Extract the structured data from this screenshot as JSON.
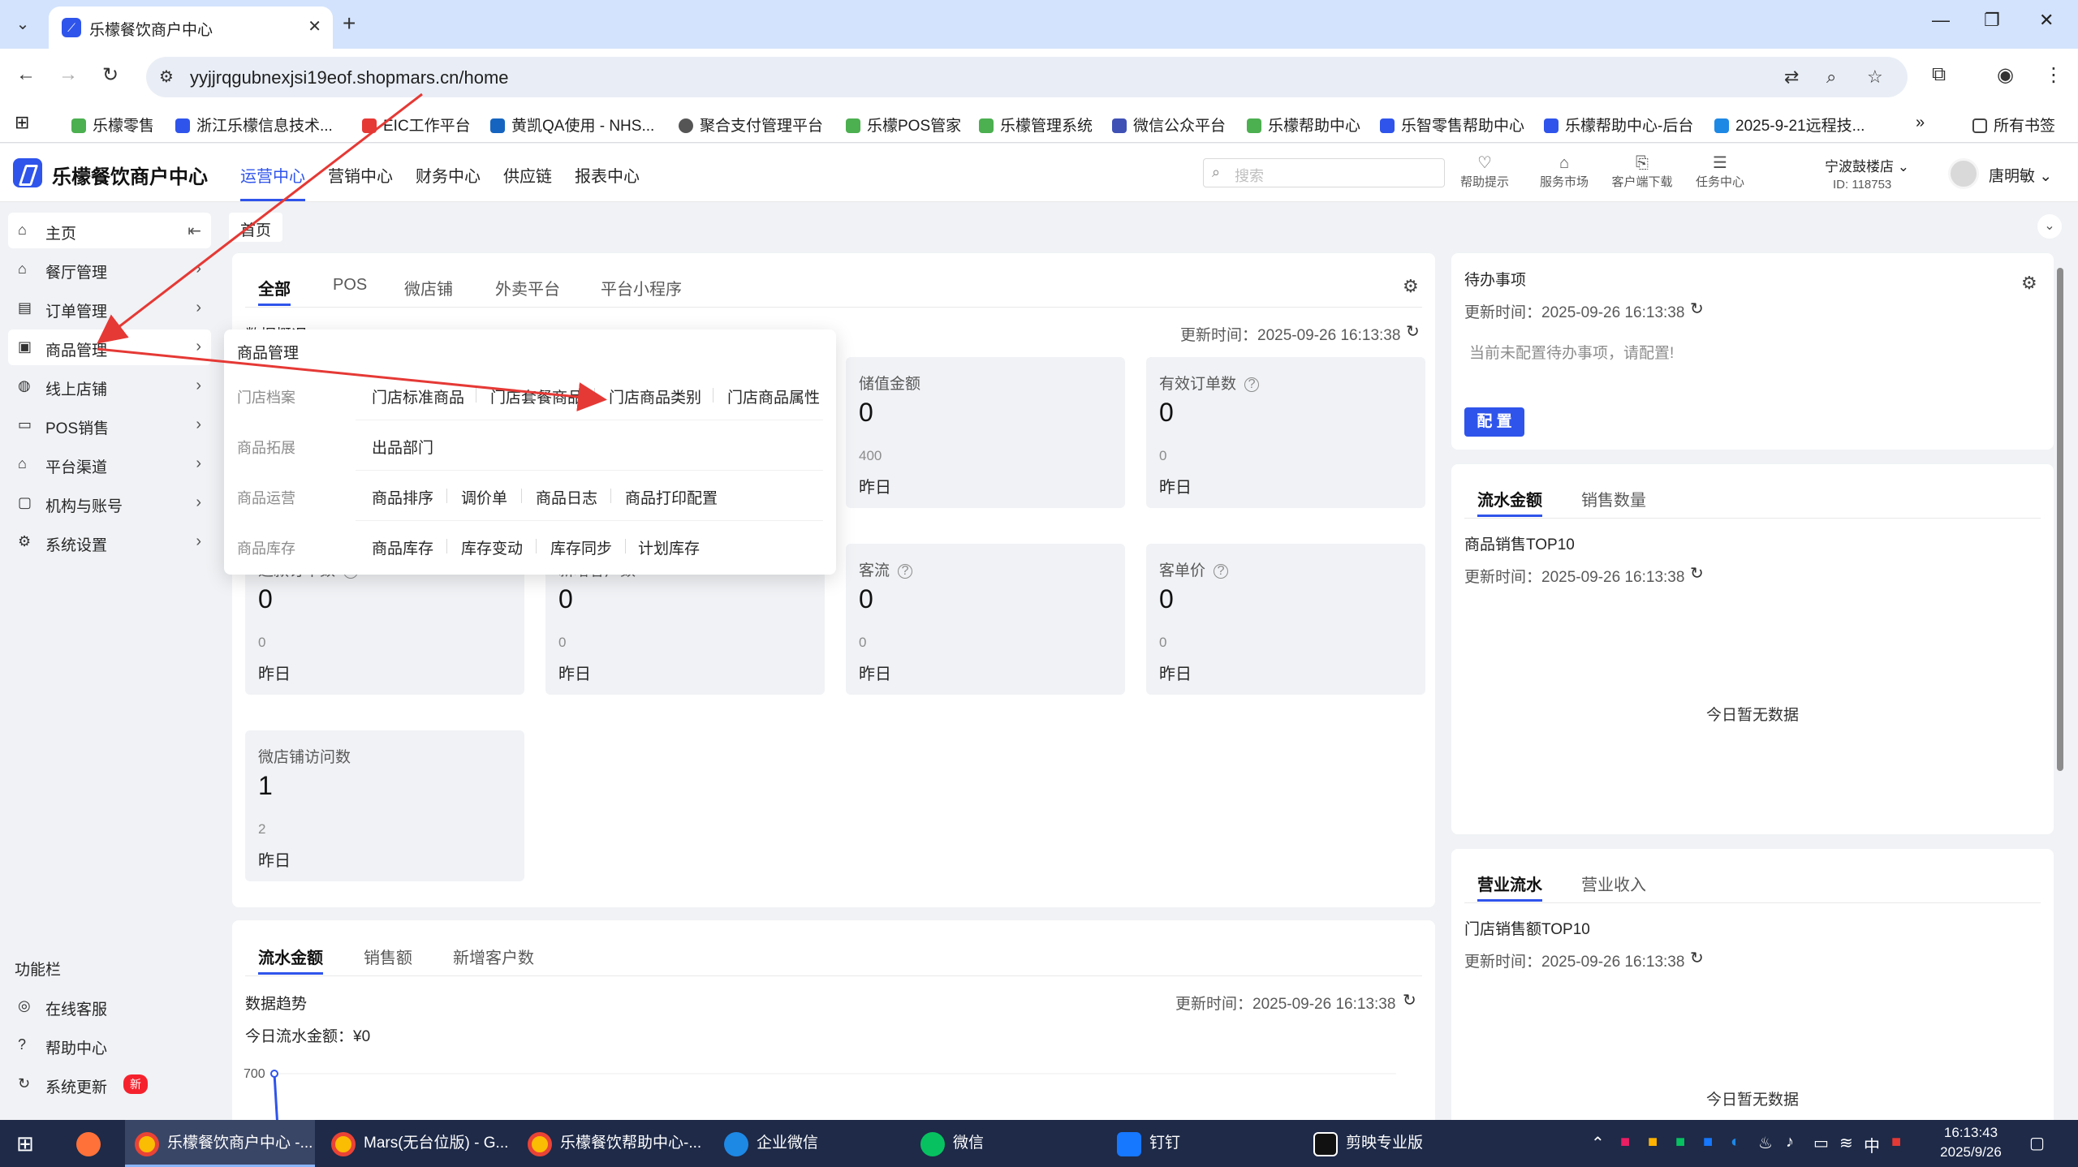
{
  "browser": {
    "tab_title": "乐檬餐饮商户中心",
    "url": "yyjjrqgubnexjsi19eof.shopmars.cn/home",
    "bookmarks": [
      {
        "label": "乐檬零售",
        "color": "#4caf50"
      },
      {
        "label": "浙江乐檬信息技术...",
        "color": "#2f54eb"
      },
      {
        "label": "EIC工作平台",
        "color": "#e53935"
      },
      {
        "label": "黄凯QA使用 - NHS...",
        "color": "#1565c0"
      },
      {
        "label": "聚合支付管理平台",
        "color": "#555555"
      },
      {
        "label": "乐檬POS管家",
        "color": "#4caf50"
      },
      {
        "label": "乐檬管理系统",
        "color": "#4caf50"
      },
      {
        "label": "微信公众平台",
        "color": "#3f51b5"
      },
      {
        "label": "乐檬帮助中心",
        "color": "#4caf50"
      },
      {
        "label": "乐智零售帮助中心",
        "color": "#2f54eb"
      },
      {
        "label": "乐檬帮助中心-后台",
        "color": "#2f54eb"
      },
      {
        "label": "2025-9-21远程技...",
        "color": "#1e88e5"
      }
    ],
    "all_bookmarks": "所有书签"
  },
  "header": {
    "logo": "乐檬餐饮商户中心",
    "nav": [
      "运营中心",
      "营销中心",
      "财务中心",
      "供应链",
      "报表中心"
    ],
    "search_placeholder": "搜索",
    "tools": [
      "帮助提示",
      "服务市场",
      "客户端下载",
      "任务中心"
    ],
    "store_name": "宁波鼓楼店",
    "store_id": "ID: 118753",
    "user_name": "唐明敏"
  },
  "sidebar": {
    "items": [
      {
        "label": "主页",
        "icon": "home-icon"
      },
      {
        "label": "餐厅管理",
        "icon": "store-icon"
      },
      {
        "label": "订单管理",
        "icon": "order-icon"
      },
      {
        "label": "商品管理",
        "icon": "product-icon"
      },
      {
        "label": "线上店铺",
        "icon": "globe-icon"
      },
      {
        "label": "POS销售",
        "icon": "pos-icon"
      },
      {
        "label": "平台渠道",
        "icon": "bank-icon"
      },
      {
        "label": "机构与账号",
        "icon": "account-icon"
      },
      {
        "label": "系统设置",
        "icon": "gear-icon"
      }
    ],
    "section_title": "功能栏",
    "bottom_items": [
      {
        "label": "在线客服"
      },
      {
        "label": "帮助中心"
      },
      {
        "label": "系统更新"
      }
    ],
    "new_badge": "新"
  },
  "breadcrumb": {
    "home": "首页"
  },
  "overview": {
    "tabs": [
      "全部",
      "POS",
      "微店铺",
      "外卖平台",
      "平台小程序"
    ],
    "section_title": "数据概况",
    "update_time": "更新时间：2025-09-26 16:13:38",
    "stats": [
      {
        "label": "储值金额",
        "value": "0",
        "prev": "400",
        "day": "昨日",
        "help": false
      },
      {
        "label": "有效订单数",
        "value": "0",
        "prev": "0",
        "day": "昨日",
        "help": true
      },
      {
        "label": "退款订单数",
        "value": "0",
        "prev": "0",
        "day": "昨日",
        "help": true
      },
      {
        "label": "新增客户数",
        "value": "0",
        "prev": "0",
        "day": "昨日",
        "help": false
      },
      {
        "label": "客流",
        "value": "0",
        "prev": "0",
        "day": "昨日",
        "help": true
      },
      {
        "label": "客单价",
        "value": "0",
        "prev": "0",
        "day": "昨日",
        "help": true
      },
      {
        "label": "微店铺访问数",
        "value": "1",
        "prev": "2",
        "day": "昨日",
        "help": false
      }
    ]
  },
  "flyout": {
    "title": "商品管理",
    "rows": [
      {
        "category": "门店档案",
        "links": [
          "门店标准商品",
          "门店套餐商品",
          "门店商品类别",
          "门店商品属性"
        ]
      },
      {
        "category": "商品拓展",
        "links": [
          "出品部门"
        ]
      },
      {
        "category": "商品运营",
        "links": [
          "商品排序",
          "调价单",
          "商品日志",
          "商品打印配置"
        ]
      },
      {
        "category": "商品库存",
        "links": [
          "商品库存",
          "库存变动",
          "库存同步",
          "计划库存"
        ]
      }
    ]
  },
  "todo": {
    "title": "待办事项",
    "update_time": "更新时间：2025-09-26 16:13:38",
    "empty": "当前未配置待办事项，请配置!",
    "config_button": "配 置"
  },
  "top10_products": {
    "tabs": [
      "流水金额",
      "销售数量"
    ],
    "title": "商品销售TOP10",
    "update_time": "更新时间：2025-09-26 16:13:38",
    "empty": "今日暂无数据"
  },
  "top10_stores": {
    "tabs": [
      "营业流水",
      "营业收入"
    ],
    "title": "门店销售额TOP10",
    "update_time": "更新时间：2025-09-26 16:13:38",
    "empty": "今日暂无数据"
  },
  "trend": {
    "tabs": [
      "流水金额",
      "销售额",
      "新增客户数"
    ],
    "title": "数据趋势",
    "update_time": "更新时间：2025-09-26 16:13:38",
    "today_total": "今日流水金额：¥0"
  },
  "chart_data": {
    "type": "line",
    "title": "数据趋势",
    "y_tick_visible": "700",
    "series": [
      {
        "values": [
          700,
          0
        ]
      }
    ]
  },
  "taskbar": {
    "apps": [
      {
        "label": "乐檬餐饮商户中心 -...",
        "color": "#fbbc04",
        "active": true
      },
      {
        "label": "Mars(无台位版) - G...",
        "color": "#fbbc04",
        "active": false
      },
      {
        "label": "乐檬餐饮帮助中心-...",
        "color": "#fbbc04",
        "active": false
      },
      {
        "label": "企业微信",
        "color": "#1e88e5",
        "active": false
      },
      {
        "label": "微信",
        "color": "#07c160",
        "active": false
      },
      {
        "label": "钉钉",
        "color": "#1677ff",
        "active": false
      },
      {
        "label": "剪映专业版",
        "color": "#111111",
        "active": false
      }
    ],
    "ime": "中",
    "time": "16:13:43",
    "date": "2025/9/26"
  }
}
